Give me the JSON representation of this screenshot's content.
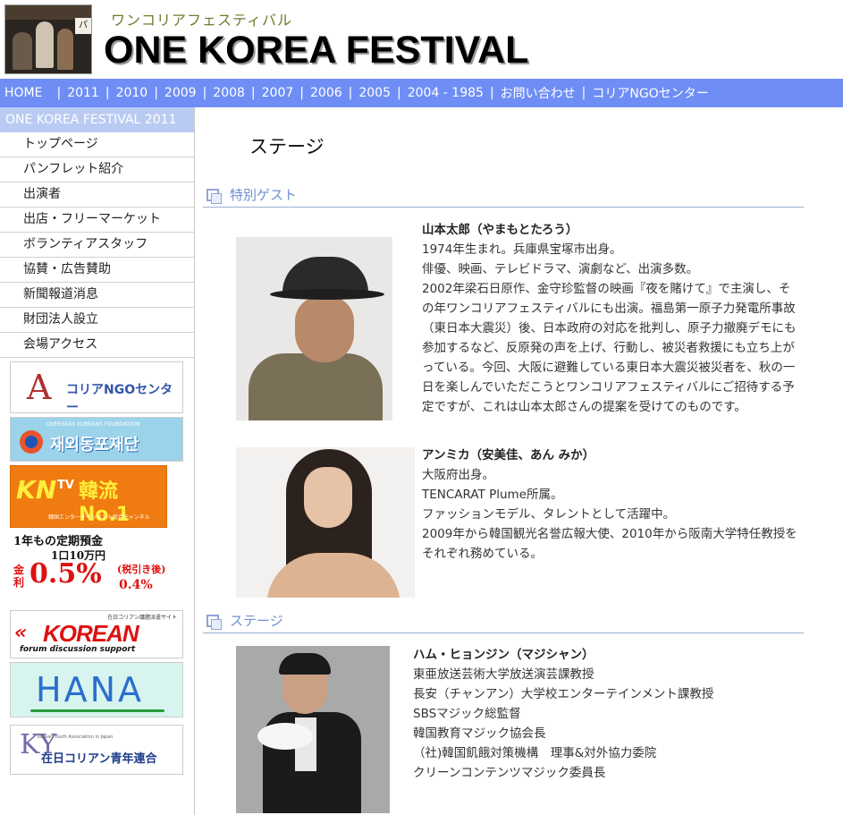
{
  "header": {
    "kana": "ワンコリアフェスティバル",
    "title": "ONE KOREA FESTIVAL",
    "photo_sign": "パナ"
  },
  "nav": {
    "items": [
      "HOME",
      "2011",
      "2010",
      "2009",
      "2008",
      "2007",
      "2006",
      "2005",
      "2004 - 1985",
      "お問い合わせ",
      "コリアNGOセンター"
    ],
    "separator": "|"
  },
  "sidebar": {
    "heading": "ONE KOREA FESTIVAL 2011",
    "items": [
      "トップページ",
      "パンフレット紹介",
      "出演者",
      "出店・フリーマーケット",
      "ボランティアスタッフ",
      "協賛・広告賛助",
      "新聞報道消息",
      "財団法人設立",
      "会場アクセス"
    ],
    "banners": {
      "ngo": {
        "mark": "A",
        "text": "コリアNGOセンター"
      },
      "okf": {
        "small": "OVERSEAS KOREANS FOUNDATION",
        "big": "재외동포재단"
      },
      "kntv": {
        "kn": "KN",
        "tv": "TV",
        "tagline": "韓流No.1",
        "sub": "韓国エンターテインメント総合チャンネル"
      },
      "bank": {
        "line1": "1年もの定期預金",
        "line2": "1口10万円",
        "kinri": "金利",
        "rate": "0.5%",
        "after_label": "(税引き後)",
        "after_rate": "0.4%"
      },
      "korean": {
        "top": "在日コリアン議題派遣サイト",
        "word": "KOREAN",
        "sub": "forum discussion support"
      },
      "hana": {
        "word": "HANA"
      },
      "youth": {
        "mark": "KY",
        "small": "Korean Youth Association in Japan",
        "text": "在日コリアン青年連合"
      }
    }
  },
  "main": {
    "page_title": "ステージ",
    "sections": [
      {
        "label": "特別ゲスト"
      },
      {
        "label": "ステージ"
      }
    ],
    "performers": [
      {
        "name": "山本太郎（やまもとたろう）",
        "lines": [
          "1974年生まれ。兵庫県宝塚市出身。",
          "俳優、映画、テレビドラマ、演劇など、出演多数。",
          "2002年梁石日原作、金守珍監督の映画『夜を賭けて』で主演し、その年ワンコリアフェスティバルにも出演。福島第一原子力発電所事故（東日本大震災）後、日本政府の対応を批判し、原子力撤廃デモにも参加するなど、反原発の声を上げ、行動し、被災者救援にも立ち上がっている。今回、大阪に避難している東日本大震災被災者を、秋の一日を楽しんでいただこうとワンコリアフェスティバルにご招待する予定ですが、これは山本太郎さんの提案を受けてのものです。"
        ]
      },
      {
        "name": "アンミカ（安美佳、あん みか）",
        "lines": [
          "大阪府出身。",
          "TENCARAT Plume所属。",
          "ファッションモデル、タレントとして活躍中。",
          "2009年から韓国観光名誉広報大使、2010年から阪南大学特任教授をそれぞれ務めている。"
        ]
      },
      {
        "name": "ハム・ヒョンジン（マジシャン）",
        "lines": [
          "東亜放送芸術大学放送演芸課教授",
          "長安（チャンアン）大学校エンターテインメント課教授",
          "SBSマジック総監督",
          "韓国教育マジック協会長",
          "（社)韓国飢餓対策機構　理事&対外協力委院",
          "クリーンコンテンツマジック委員長"
        ]
      }
    ]
  }
}
